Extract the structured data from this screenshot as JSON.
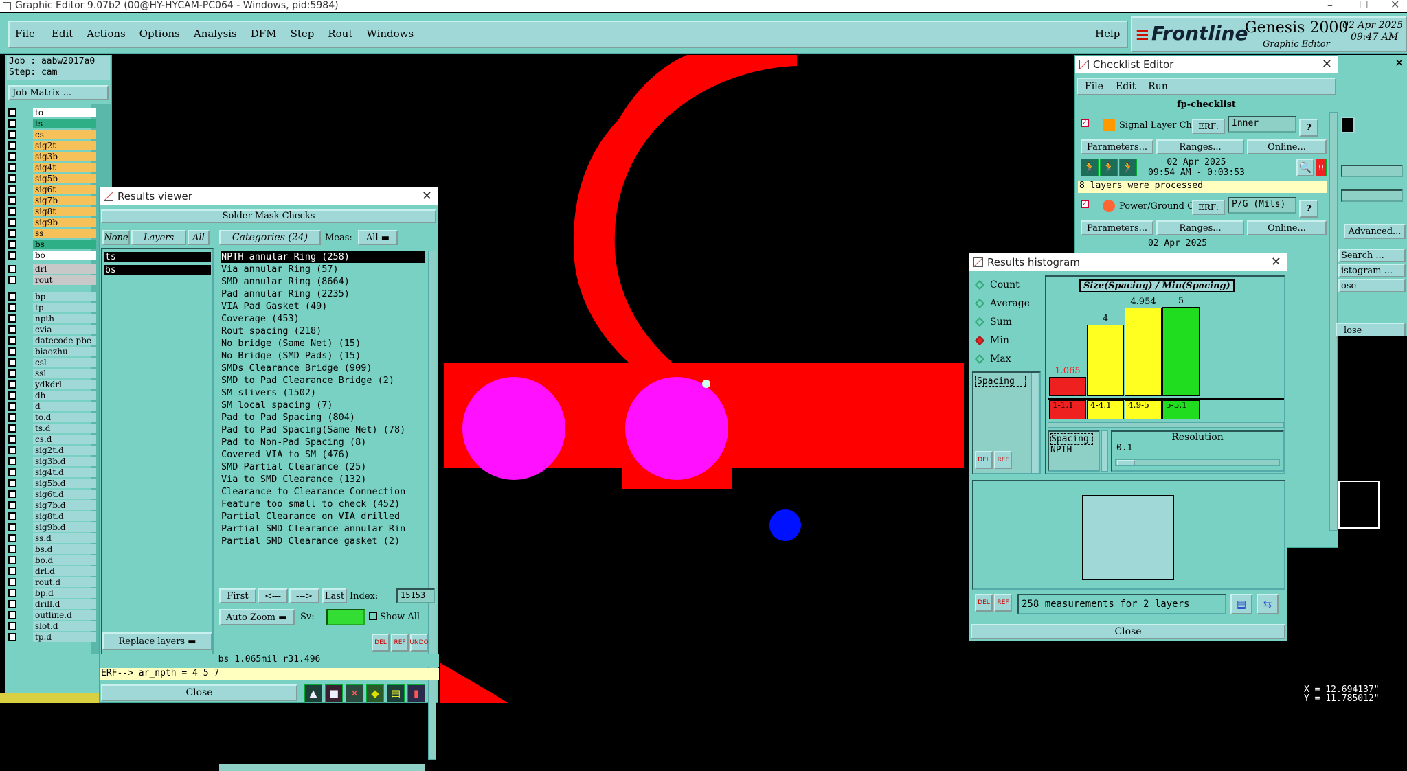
{
  "app": {
    "title": "Graphic Editor 9.07b2 (00@HY-HYCAM-PC064 - Windows, pid:5984)",
    "menu": [
      "File",
      "Edit",
      "Actions",
      "Options",
      "Analysis",
      "DFM",
      "Step",
      "Rout",
      "Windows"
    ],
    "help": "Help",
    "brand": "Frontline",
    "product": "Genesis 2000",
    "subtitle": "Graphic Editor",
    "date": "02 Apr 2025",
    "time": "09:47 AM"
  },
  "left": {
    "job": "Job : aabw2017a0",
    "step": "Step: cam",
    "matrix_button": "Job Matrix ...",
    "layers": [
      {
        "name": "to",
        "color": "#ffffff"
      },
      {
        "name": "ts",
        "color": "#2eaf86"
      },
      {
        "name": "cs",
        "color": "#f7c15a"
      },
      {
        "name": "sig2t",
        "color": "#f7c15a"
      },
      {
        "name": "sig3b",
        "color": "#f7c15a"
      },
      {
        "name": "sig4t",
        "color": "#f7c15a"
      },
      {
        "name": "sig5b",
        "color": "#f7c15a"
      },
      {
        "name": "sig6t",
        "color": "#f7c15a"
      },
      {
        "name": "sig7b",
        "color": "#f7c15a"
      },
      {
        "name": "sig8t",
        "color": "#f7c15a"
      },
      {
        "name": "sig9b",
        "color": "#f7c15a"
      },
      {
        "name": "ss",
        "color": "#f7c15a"
      },
      {
        "name": "bs",
        "color": "#2eaf86"
      },
      {
        "name": "bo",
        "color": "#ffffff"
      }
    ],
    "layers2": [
      {
        "name": "drl",
        "color": "#c8c8c8"
      },
      {
        "name": "rout",
        "color": "#c8c8c8"
      }
    ],
    "layers3": [
      "bp",
      "tp",
      "npth",
      "cvia",
      "datecode-pbe",
      "biaozhu",
      "csl",
      "ssl",
      "ydkdrl",
      "dh",
      "d",
      "to.d",
      "ts.d",
      "cs.d",
      "sig2t.d",
      "sig3b.d",
      "sig4t.d",
      "sig5b.d",
      "sig6t.d",
      "sig7b.d",
      "sig8t.d",
      "sig9b.d",
      "ss.d",
      "bs.d",
      "bo.d",
      "drl.d",
      "rout.d",
      "bp.d",
      "drill.d",
      "outline.d",
      "slot.d",
      "tp.d"
    ]
  },
  "results": {
    "title": "Results viewer",
    "header": "Solder Mask Checks",
    "none": "None",
    "layers_label": "Layers",
    "all": "All",
    "categories_label": "Categories (24)",
    "meas_label": "Meas:",
    "meas_value": "All",
    "sel_layers": [
      "ts",
      "bs"
    ],
    "categories": [
      "NPTH annular Ring (258)",
      "Via annular Ring (57)",
      "SMD annular Ring (8664)",
      "Pad annular Ring (2235)",
      "VIA Pad Gasket (49)",
      "Coverage (453)",
      "Rout spacing (218)",
      "No bridge (Same Net) (15)",
      "No Bridge (SMD Pads) (15)",
      "SMDs Clearance Bridge (909)",
      "SMD to Pad Clearance Bridge (2)",
      "SM slivers (1502)",
      "SM local spacing (7)",
      "Pad to Pad Spacing (804)",
      "Pad to Pad Spacing(Same Net) (78)",
      "Pad to Non-Pad Spacing (8)",
      "Covered VIA to SM (476)",
      "SMD Partial Clearance (25)",
      "Via to SMD Clearance (132)",
      "Clearance to Clearance Connection",
      "Feature too small to check (452)",
      "Partial Clearance on VIA drilled",
      "Partial SMD Clearance annular Rin",
      "Partial SMD Clearance gasket (2)"
    ],
    "first": "First",
    "prev": "<---",
    "next": "--->",
    "last": "Last",
    "index_label": "Index:",
    "index_value": "15153",
    "autozoom": "Auto Zoom",
    "sv": "Sv:",
    "showall": "Show All",
    "replace": "Replace layers",
    "status": "bs 1.065mil  r31.496",
    "erf": "ERF--> ar_npth = 4 5 7",
    "close": "Close"
  },
  "checklist": {
    "title": "Checklist Editor",
    "menu": [
      "File",
      "Edit",
      "Run"
    ],
    "name": "fp-checklist",
    "item1": "Signal Layer Ch",
    "erf": "ERF:",
    "erf1": "Inner",
    "params": "Parameters...",
    "ranges": "Ranges...",
    "online": "Online...",
    "date1": "02 Apr 2025",
    "time1": "09:54 AM - 0:03:53",
    "processed": "8 layers were processed",
    "item2": "Power/Ground C",
    "erf2": "P/G (Mils)",
    "date2": "02 Apr 2025",
    "advanced": "Advanced...",
    "search": "Search ...",
    "histogram": "istogram ...",
    "close": "ose",
    "close2": "lose"
  },
  "histogram": {
    "title": "Results histogram",
    "options": [
      "Count",
      "Average",
      "Sum",
      "Min",
      "Max"
    ],
    "selected": "Min",
    "chart_title": "Size(Spacing) / Min(Spacing)",
    "list": [
      "Spacing"
    ],
    "meas_list": [
      "Spacing",
      "NPTH"
    ],
    "resolution_label": "Resolution",
    "resolution": "0.1",
    "summary": "258 measurements for 2 layers",
    "close": "Close",
    "chart_data": {
      "type": "bar",
      "categories": [
        "1-1.1",
        "4-4.1",
        "4.9-5",
        "5-5.1"
      ],
      "values": [
        1.065,
        4,
        4.954,
        5
      ],
      "title": "Size(Spacing) / Min(Spacing)",
      "colors": [
        "#ee2020",
        "#ffff20",
        "#ffff20",
        "#20dd20"
      ]
    }
  },
  "coords": {
    "x": "X = 12.694137\"",
    "y": "Y = 11.785012\""
  },
  "colors": {
    "panel": "#79d1c3",
    "red": "#ff0000",
    "pad": "#ff11ff",
    "blue": "#0011ff"
  }
}
